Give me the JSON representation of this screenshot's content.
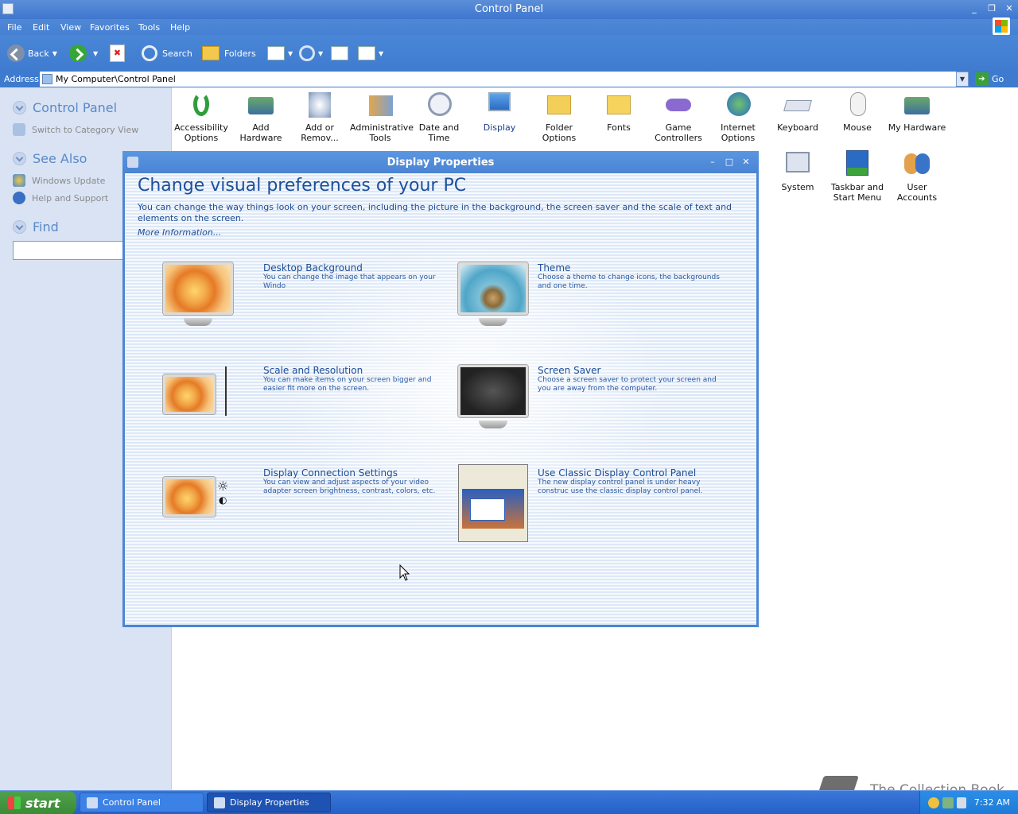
{
  "window": {
    "title": "Control Panel"
  },
  "menubar": [
    "File",
    "Edit",
    "View",
    "Favorites",
    "Tools",
    "Help"
  ],
  "toolbar": {
    "back": "Back",
    "search": "Search",
    "folders": "Folders"
  },
  "address": {
    "label": "Address",
    "value": "My Computer\\Control Panel",
    "go": "Go"
  },
  "leftpane": {
    "panel_title": "Control Panel",
    "switch_view": "Switch to Category View",
    "see_also": "See Also",
    "windows_update": "Windows Update",
    "help_support": "Help and Support",
    "find": "Find"
  },
  "icons": [
    {
      "label": "Accessibility Options"
    },
    {
      "label": "Add Hardware"
    },
    {
      "label": "Add or Remov..."
    },
    {
      "label": "Administrative Tools"
    },
    {
      "label": "Date and Time"
    },
    {
      "label": "Display"
    },
    {
      "label": "Folder Options"
    },
    {
      "label": "Fonts"
    },
    {
      "label": "Game Controllers"
    },
    {
      "label": "Internet Options"
    },
    {
      "label": "Keyboard"
    },
    {
      "label": "Mouse"
    },
    {
      "label": "My Hardware"
    },
    {
      "label": "System"
    },
    {
      "label": "Taskbar and Start Menu"
    },
    {
      "label": "User Accounts"
    }
  ],
  "dialog": {
    "title": "Display Properties",
    "heading": "Change visual preferences of your PC",
    "description": "You can change the way things look on your screen, including the picture in the background, the screen saver and the scale of text and elements on the screen.",
    "more_info": "More Information...",
    "options": [
      {
        "title": "Desktop Background",
        "desc": "You can change the image that appears on your Windo"
      },
      {
        "title": "Theme",
        "desc": "Choose a theme to change icons, the backgrounds and one time."
      },
      {
        "title": "Scale and Resolution",
        "desc": "You can make items on your screen bigger and easier fit more on the screen."
      },
      {
        "title": "Screen Saver",
        "desc": "Choose a screen saver to protect your screen and you are away from the computer."
      },
      {
        "title": "Display Connection Settings",
        "desc": "You can view and adjust aspects of your video adapter screen brightness, contrast, colors, etc."
      },
      {
        "title": "Use Classic Display Control Panel",
        "desc": "The new display control panel is under heavy construc use the classic display control panel."
      }
    ]
  },
  "taskbar": {
    "start": "start",
    "tasks": [
      "Control Panel",
      "Display Properties"
    ],
    "clock": "7:32 AM"
  },
  "watermark": "The Collection Book"
}
